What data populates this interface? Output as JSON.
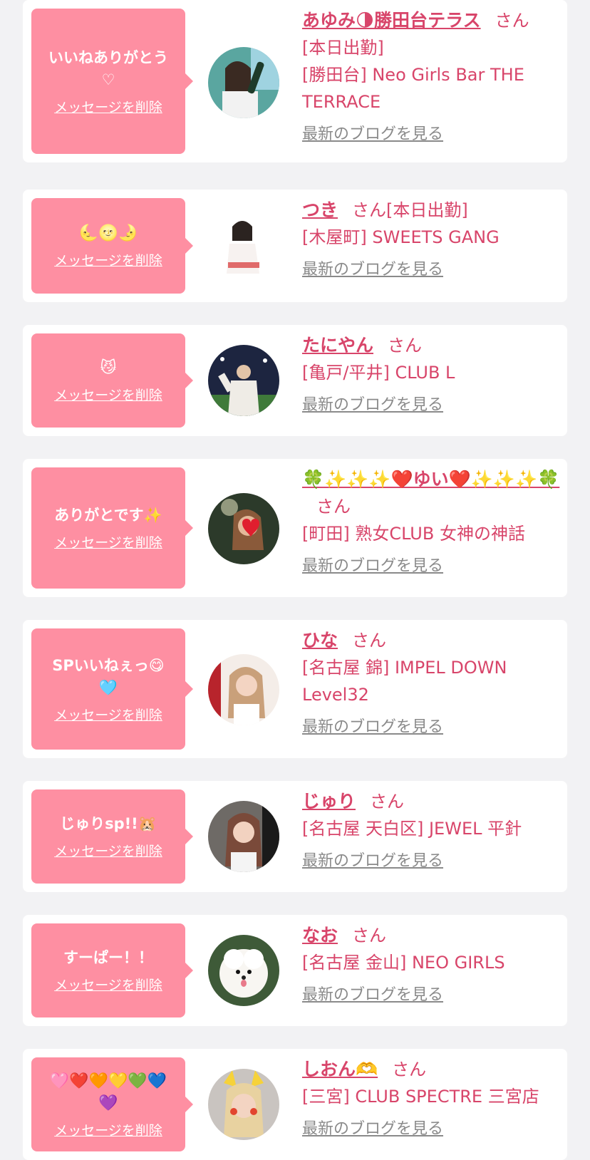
{
  "delete_label": "メッセージを削除",
  "san_label": "さん",
  "blog_label": "最新のブログを見る",
  "colors": {
    "background": "#f2f2f4",
    "card": "#ffffff",
    "bubble": "#fe8fa2",
    "accent_text": "#d8456a",
    "link_gray": "#8a8a8a"
  },
  "entries": [
    {
      "message": "いいねありがとう\n♡",
      "name": "あゆみ🌗勝田台テラス",
      "status": "",
      "status_line": "[本日出勤]",
      "shop": "[勝田台] Neo Girls Bar THE TERRACE",
      "avatar_icon": "woman-with-bottle-photo"
    },
    {
      "message": "🌜🌝🌛",
      "name": "つき",
      "status": "[本日出勤]",
      "status_line": "",
      "shop": "[木屋町] SWEETS GANG",
      "avatar_icon": "woman-in-white-outfit-photo"
    },
    {
      "message": "😼",
      "name": "たにやん",
      "status": "",
      "status_line": "",
      "shop": "[亀戸/平井] CLUB L",
      "avatar_icon": "baseball-stadium-photo"
    },
    {
      "message": "ありがとです✨",
      "name": "🍀✨✨✨❤️ゆい❤️✨✨✨🍀",
      "status": "",
      "status_line": "",
      "shop": "[町田] 熟女CLUB 女神の神話",
      "avatar_icon": "woman-with-heart-sticker-photo"
    },
    {
      "message": "SPいいねぇっ😋\n🩵",
      "name": "ひな",
      "status": "",
      "status_line": "",
      "shop": "[名古屋 錦] IMPEL DOWN Level32",
      "avatar_icon": "woman-selfie-photo"
    },
    {
      "message": "じゅりsp!!🐹",
      "name": "じゅり",
      "status": "",
      "status_line": "",
      "shop": "[名古屋 天白区] JEWEL 平針",
      "avatar_icon": "woman-portrait-photo"
    },
    {
      "message": "すーぱー！！",
      "name": "なお",
      "status": "",
      "status_line": "",
      "shop": "[名古屋 金山] NEO GIRLS",
      "avatar_icon": "white-pomeranian-photo"
    },
    {
      "message": "🩷❤️🧡💛💚💙\n💜",
      "name": "しおん🫶",
      "status": "",
      "status_line": "",
      "shop": "[三宮] CLUB SPECTRE 三宮店",
      "avatar_icon": "woman-with-pikachu-filter-photo"
    }
  ]
}
